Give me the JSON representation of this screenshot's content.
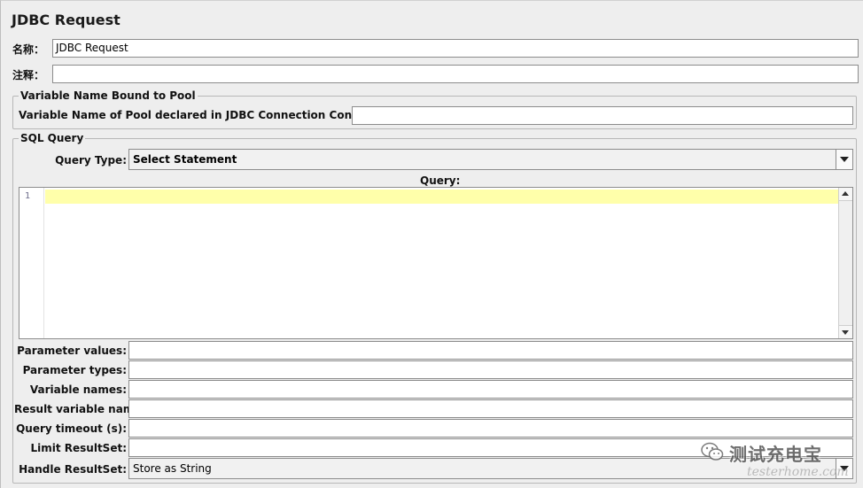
{
  "panel": {
    "title": "JDBC Request"
  },
  "fields": {
    "name_label": "名称：",
    "name_value": "JDBC Request",
    "comment_label": "注释：",
    "comment_value": ""
  },
  "pool_group": {
    "legend": "Variable Name Bound to Pool",
    "pool_label": "Variable Name of Pool declared in JDBC Connection Configuration:",
    "pool_value": ""
  },
  "sql_group": {
    "legend": "SQL Query",
    "query_type_label": "Query Type:",
    "query_type_value": "Select Statement",
    "query_label": "Query:",
    "editor": {
      "line_number": "1",
      "current_line_color": "#ffffaa"
    },
    "params": [
      {
        "label": "Parameter values:",
        "value": ""
      },
      {
        "label": "Parameter types:",
        "value": ""
      },
      {
        "label": "Variable names:",
        "value": ""
      },
      {
        "label": "Result variable name:",
        "value": ""
      },
      {
        "label": "Query timeout (s):",
        "value": ""
      },
      {
        "label": "Limit ResultSet:",
        "value": ""
      }
    ],
    "handle_resultset_label": "Handle ResultSet:",
    "handle_resultset_value": "Store as String"
  },
  "watermark": {
    "icon": "wechat-icon",
    "text": "测试充电宝",
    "sub": "testerhome.com"
  }
}
